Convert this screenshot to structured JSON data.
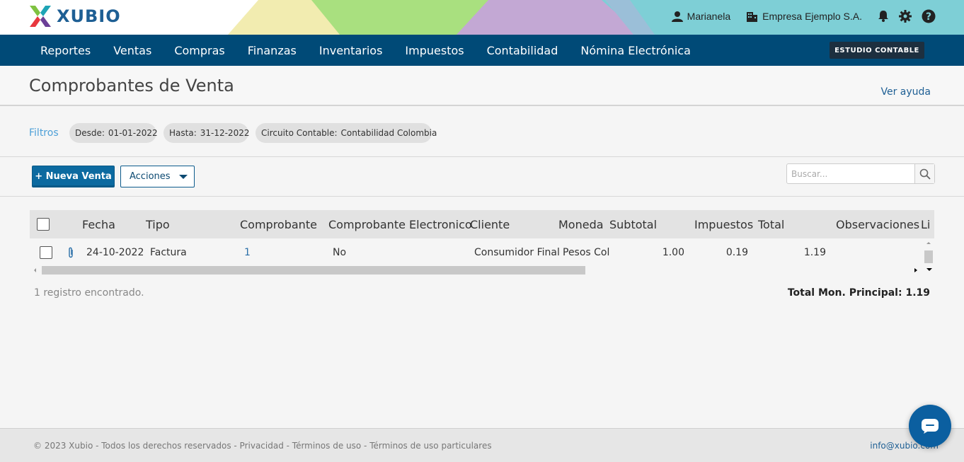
{
  "brand": {
    "name": "XUBIO",
    "colors": {
      "nav": "#004a77",
      "primary": "#0c6aa0",
      "link": "#1e5f94"
    }
  },
  "topbar": {
    "user": {
      "icon": "user-icon",
      "name": "Marianela"
    },
    "company": {
      "icon": "building-icon",
      "name": "Empresa Ejemplo S.A."
    },
    "icons": [
      "bell-icon",
      "gear-icon",
      "help-icon"
    ]
  },
  "nav": {
    "items": [
      "Reportes",
      "Ventas",
      "Compras",
      "Finanzas",
      "Inventarios",
      "Impuestos",
      "Contabilidad",
      "Nómina Electrónica"
    ],
    "badge": "ESTUDIO CONTABLE"
  },
  "page": {
    "title": "Comprobantes de Venta",
    "help": "Ver ayuda"
  },
  "filters": {
    "label": "Filtros",
    "chips": [
      {
        "key": "Desde:",
        "value": "01-01-2022"
      },
      {
        "key": "Hasta:",
        "value": "31-12-2022"
      },
      {
        "key": "Circuito Contable:",
        "value": "Contabilidad Colombia"
      }
    ]
  },
  "toolbar": {
    "new_label": "+ Nueva Venta",
    "actions_label": "Acciones",
    "search_placeholder": "Buscar..."
  },
  "grid": {
    "columns": [
      "Fecha",
      "Tipo",
      "Comprobante",
      "Comprobante Electronico",
      "Cliente",
      "Moneda",
      "Subtotal",
      "Impuestos",
      "Total",
      "Observaciones",
      "Li"
    ],
    "rows": [
      {
        "fecha": "24-10-2022",
        "tipo": "Factura",
        "comprobante": "1",
        "electronico": "No",
        "cliente": "Consumidor Final",
        "moneda": "Pesos Col",
        "subtotal": "1.00",
        "impuestos": "0.19",
        "total": "1.19"
      }
    ]
  },
  "summary": {
    "records": "1 registro encontrado.",
    "total": "Total Mon. Principal: 1.19"
  },
  "footer": {
    "copyright": "© 2023 Xubio - Todos los derechos reservados - Privacidad - Términos de uso - Términos de uso particulares",
    "email": "info@xubio.com"
  }
}
